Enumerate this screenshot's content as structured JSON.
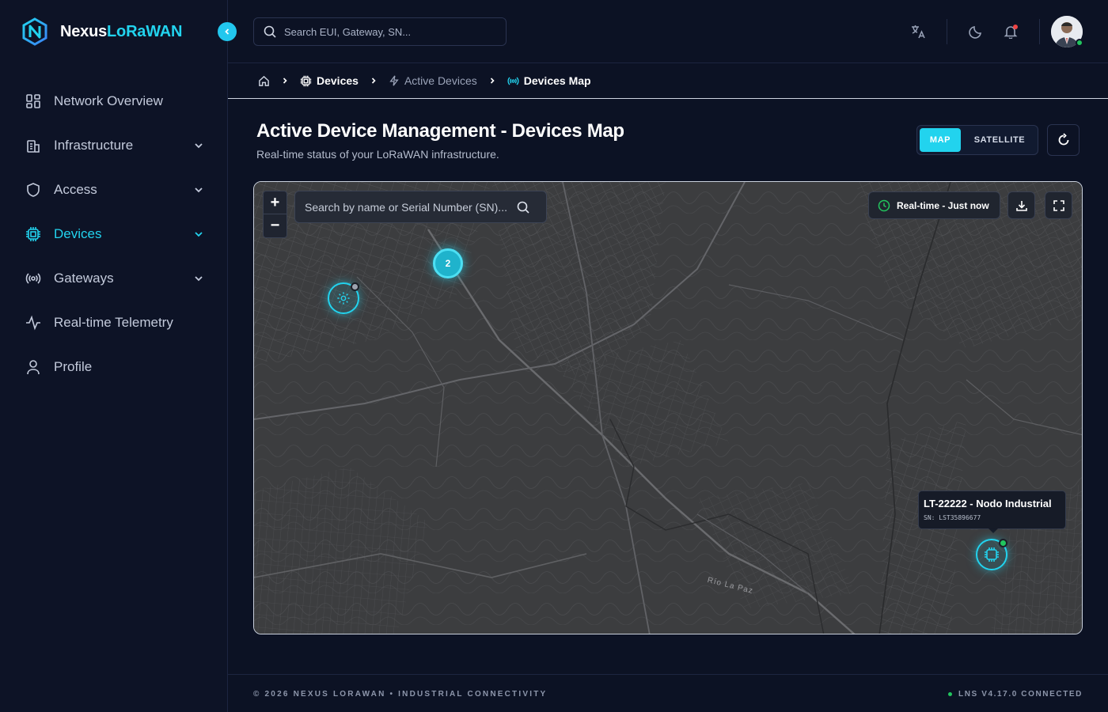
{
  "brand": {
    "name_part1": "Nexus",
    "name_part2": "LoRaWAN"
  },
  "sidebar": {
    "items": [
      {
        "label": "Network Overview",
        "icon": "grid-icon",
        "expandable": false,
        "active": false
      },
      {
        "label": "Infrastructure",
        "icon": "building-icon",
        "expandable": true,
        "active": false
      },
      {
        "label": "Access",
        "icon": "shield-icon",
        "expandable": true,
        "active": false
      },
      {
        "label": "Devices",
        "icon": "chip-icon",
        "expandable": true,
        "active": true
      },
      {
        "label": "Gateways",
        "icon": "radio-signal-icon",
        "expandable": true,
        "active": false
      },
      {
        "label": "Real-time Telemetry",
        "icon": "activity-icon",
        "expandable": false,
        "active": false
      },
      {
        "label": "Profile",
        "icon": "user-icon",
        "expandable": false,
        "active": false
      }
    ]
  },
  "topbar": {
    "search_placeholder": "Search EUI, Gateway, SN..."
  },
  "breadcrumb": {
    "level1": "Devices",
    "level2": "Active Devices",
    "level3": "Devices Map"
  },
  "header": {
    "title": "Active Device Management - Devices Map",
    "subtitle": "Real-time status of your LoRaWAN infrastructure.",
    "view_map": "MAP",
    "view_satellite": "SATELLITE",
    "active_view": "MAP"
  },
  "map": {
    "zoom_in": "+",
    "zoom_out": "−",
    "search_placeholder": "Search by name or Serial Number (SN)...",
    "realtime_label": "Real-time - Just now",
    "cluster_count": "2",
    "river_label": "Río La Paz",
    "tooltip": {
      "title": "LT-22222 - Nodo Industrial",
      "sn": "SN: LST35896677"
    },
    "markers": [
      {
        "name": "gateway-marker",
        "icon": "gear-icon",
        "status": "offline",
        "status_color": "#9ca3af"
      },
      {
        "name": "device-marker",
        "icon": "chip-icon",
        "status": "online",
        "status_color": "#22c55e"
      }
    ]
  },
  "footer": {
    "left": "© 2026 NEXUS LORAWAN • INDUSTRIAL CONNECTIVITY",
    "right": "LNS V4.17.0 CONNECTED"
  },
  "colors": {
    "accent": "#22d3ee",
    "background": "#0c1224",
    "online": "#22c55e"
  }
}
